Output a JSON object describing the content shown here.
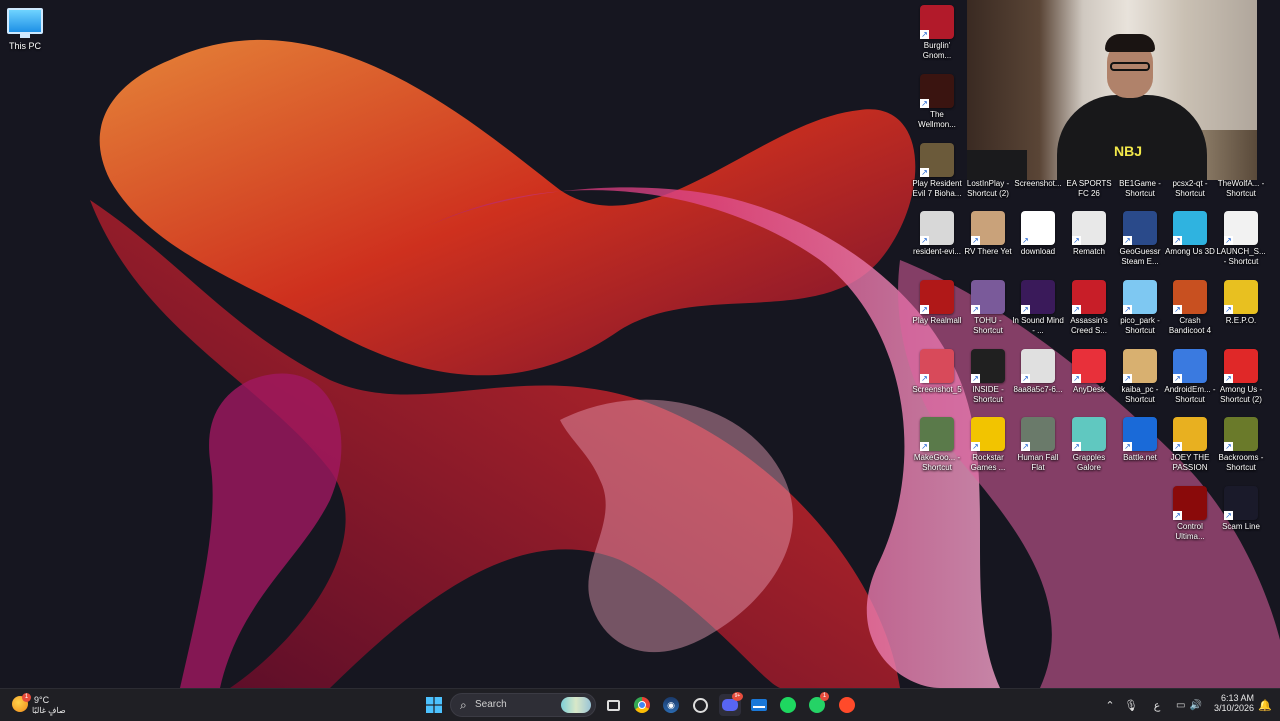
{
  "desktop": {
    "this_pc_label": "This PC",
    "icons": [
      {
        "label": "Burglin' Gnom...",
        "color": "#b21a2a"
      },
      {
        "label": "The Wellmon...",
        "color": "#3a1410"
      },
      {
        "label": "Play Resident Evil 7 Bioha...",
        "color": "#6b5a3a"
      },
      {
        "label": "resident-evi...",
        "color": "#d8d8d8"
      },
      {
        "label": "RV There Yet",
        "color": "#c9a27a"
      },
      {
        "label": "download",
        "color": "#ffffff"
      },
      {
        "label": "Rematch",
        "color": "#e8e8e8"
      },
      {
        "label": "GeoGuessr Steam E...",
        "color": "#2a4a8a"
      },
      {
        "label": "Among Us 3D",
        "color": "#2fb3e0"
      },
      {
        "label": "LAUNCH_S... - Shortcut",
        "color": "#f2f2f2"
      },
      {
        "label": "Play Realmall",
        "color": "#b01818"
      },
      {
        "label": "TOHU - Shortcut",
        "color": "#7a5a9a"
      },
      {
        "label": "In Sound Mind - ...",
        "color": "#3a1a5a"
      },
      {
        "label": "Assassin's Creed S...",
        "color": "#c81e28"
      },
      {
        "label": "pico_park - Shortcut",
        "color": "#7ec8f2"
      },
      {
        "label": "Crash Bandicoot 4",
        "color": "#c85020"
      },
      {
        "label": "R.E.P.O.",
        "color": "#e8c020"
      },
      {
        "label": "Screenshot_5",
        "color": "#d84a5a"
      },
      {
        "label": "INSIDE - Shortcut",
        "color": "#202020"
      },
      {
        "label": "8aa8a5c7-6...",
        "color": "#e0e0e0"
      },
      {
        "label": "AnyDesk",
        "color": "#e8303a"
      },
      {
        "label": "kaiba_pc - Shortcut",
        "color": "#d8b070"
      },
      {
        "label": "AndroidEm... - Shortcut",
        "color": "#3a7ae0"
      },
      {
        "label": "Among Us - Shortcut (2)",
        "color": "#e02828"
      },
      {
        "label": "MakeGoo... - Shortcut",
        "color": "#5a7a4a"
      },
      {
        "label": "Rockstar Games ...",
        "color": "#f2c400"
      },
      {
        "label": "Human Fall Flat",
        "color": "#6a7a6a"
      },
      {
        "label": "Grapples Galore",
        "color": "#60c8c0"
      },
      {
        "label": "Battle.net",
        "color": "#1a6ad8"
      },
      {
        "label": "JOEY THE PASSION",
        "color": "#e8b020"
      },
      {
        "label": "Backrooms - Shortcut",
        "color": "#6a7a2a"
      },
      {
        "label": "Control Ultima...",
        "color": "#8a0a0a"
      },
      {
        "label": "Scam Line",
        "color": "#1a1a2a"
      },
      {
        "label": "LostInPlay - Shortcut (2)",
        "color": "#4a3a2a"
      },
      {
        "label": "Screenshot...",
        "color": "#4a3a2a"
      },
      {
        "label": "EA SPORTS FC 26",
        "color": "#4a3a2a"
      },
      {
        "label": "BE1Game - Shortcut",
        "color": "#4a3a2a"
      },
      {
        "label": "pcsx2-qt - Shortcut",
        "color": "#4a3a2a"
      },
      {
        "label": "TheWolfA... - Shortcut",
        "color": "#4a3a2a"
      }
    ]
  },
  "webcam": {
    "shirt_text": "NBJ"
  },
  "taskbar": {
    "weather": {
      "temp": "9°C",
      "condition": "صافٍ غالبًا",
      "badge": "1"
    },
    "search_label": "Search",
    "apps": [
      {
        "name": "start-button",
        "icon": "windows-icon"
      },
      {
        "name": "task-view-button",
        "icon": "task-view-icon"
      },
      {
        "name": "chrome-app",
        "icon": "chrome-icon"
      },
      {
        "name": "steam-app",
        "icon": "steam-icon"
      },
      {
        "name": "github-app",
        "icon": "github-icon"
      },
      {
        "name": "discord-app",
        "icon": "discord-icon",
        "badge": "9+"
      },
      {
        "name": "mail-app",
        "icon": "mail-icon"
      },
      {
        "name": "spotify-app",
        "icon": "spotify-icon"
      },
      {
        "name": "whatsapp-app",
        "icon": "whatsapp-icon",
        "badge": "1"
      },
      {
        "name": "ea-app",
        "icon": "ea-icon"
      }
    ],
    "tray": {
      "language": "ع",
      "time": "6:13 AM",
      "date": "3/10/2026"
    }
  }
}
